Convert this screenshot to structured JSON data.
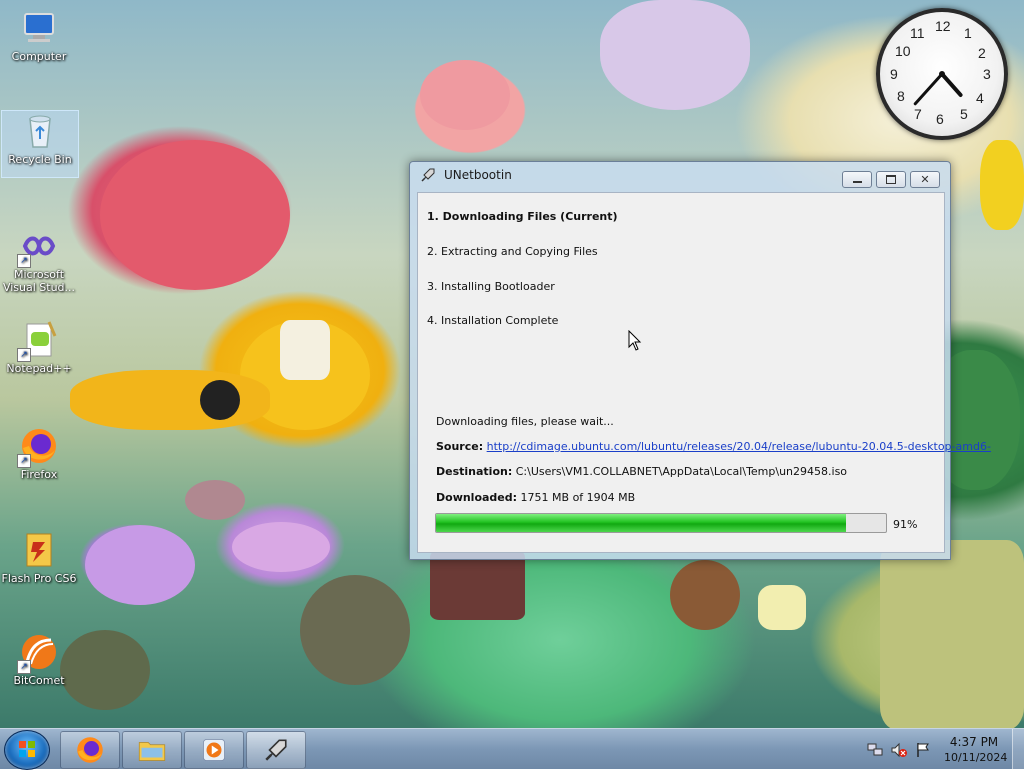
{
  "desktop": {
    "icons": [
      {
        "label": "Computer",
        "icon": "computer-icon"
      },
      {
        "label": "Recycle Bin",
        "icon": "recycle-bin-icon"
      },
      {
        "label": "Microsoft Visual Stud...",
        "icon": "visual-studio-icon"
      },
      {
        "label": "Notepad++",
        "icon": "notepad-plus-plus-icon"
      },
      {
        "label": "Firefox",
        "icon": "firefox-icon"
      },
      {
        "label": "Flash Pro CS6",
        "icon": "flash-pro-icon"
      },
      {
        "label": "BitComet",
        "icon": "bitcomet-icon"
      }
    ],
    "clock_gadget": {
      "numbers": [
        "12",
        "1",
        "2",
        "3",
        "4",
        "5",
        "6",
        "7",
        "8",
        "9",
        "10",
        "11"
      ],
      "hour": 4,
      "minute": 37
    }
  },
  "window": {
    "title": "UNetbootin",
    "steps": [
      "1. Downloading Files (Current)",
      "2. Extracting and Copying Files",
      "3. Installing Bootloader",
      "4. Installation Complete"
    ],
    "status": "Downloading files, please wait...",
    "source_label": "Source:",
    "source_url": "http://cdimage.ubuntu.com/lubuntu/releases/20.04/release/lubuntu-20.04.5-desktop-amd6-",
    "destination_label": "Destination:",
    "destination_path": "C:\\Users\\VM1.COLLABNET\\AppData\\Local\\Temp\\un29458.iso",
    "downloaded_label": "Downloaded:",
    "downloaded_value": "1751 MB of 1904 MB",
    "progress_percent": 91,
    "progress_text": "91%"
  },
  "taskbar": {
    "buttons": [
      {
        "name": "firefox",
        "icon": "firefox-icon"
      },
      {
        "name": "file-explorer",
        "icon": "folder-icon"
      },
      {
        "name": "media-player",
        "icon": "media-player-icon"
      },
      {
        "name": "unetbootin",
        "icon": "unetbootin-icon"
      }
    ],
    "time": "4:37 PM",
    "date": "10/11/2024"
  },
  "colors": {
    "progress_fill": "#22c322",
    "link": "#1a3fc8",
    "taskbar": "#7c97b5"
  }
}
